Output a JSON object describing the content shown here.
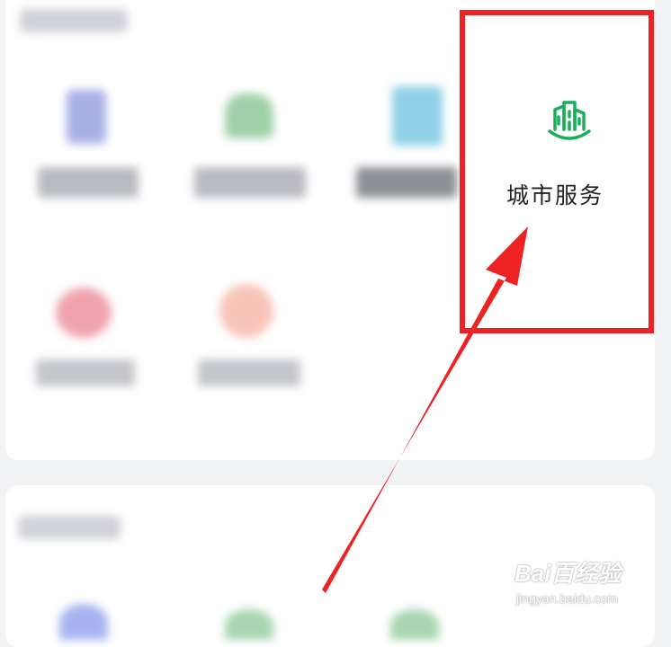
{
  "service": {
    "label": "城市服务",
    "icon": "city-buildings-icon",
    "accent": "#1aad5c"
  },
  "highlight_color": "#ee2222",
  "watermark": {
    "logo": "Bai百经验",
    "url": "jingyan.baidu.com"
  }
}
